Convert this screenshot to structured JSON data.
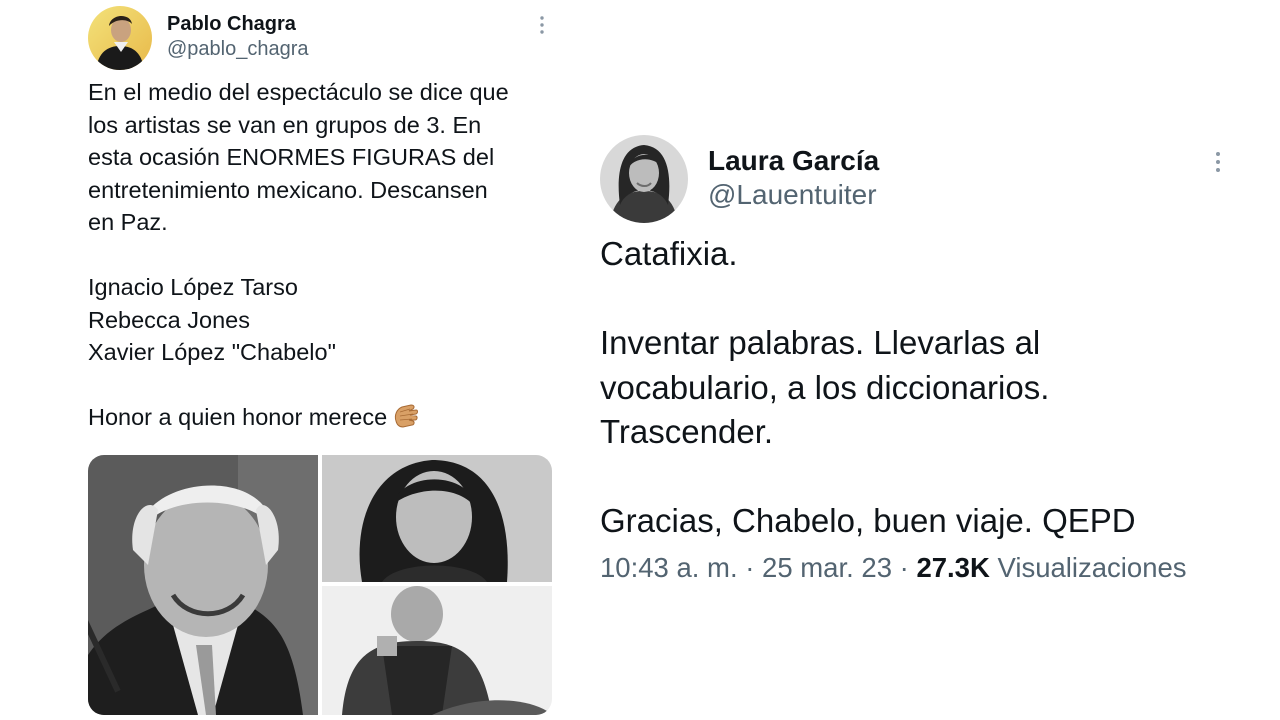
{
  "left_tweet": {
    "author_name": "Pablo Chagra",
    "author_handle": "@pablo_chagra",
    "body_lines_1": [
      "En el medio del espectáculo se dice que",
      "los artistas se van en grupos de 3. En",
      "esta ocasión ENORMES FIGURAS del",
      "entretenimiento mexicano. Descansen",
      "en Paz."
    ],
    "names_list": [
      "Ignacio López Tarso",
      "Rebecca Jones",
      "Xavier López \"Chabelo\""
    ],
    "closing_line": "Honor a quien honor merece",
    "closing_emoji_icon": "clapping-hands-icon",
    "media_count": 3
  },
  "right_tweet": {
    "author_name": "Laura García",
    "author_handle": "@Lauentuiter",
    "body_line_1": "Catafixia.",
    "body_lines_2": [
      "Inventar palabras. Llevarlas al",
      "vocabulario, a los diccionarios.",
      "Trascender."
    ],
    "body_line_3": "Gracias, Chabelo, buen viaje. QEPD",
    "time": "10:43 a. m.",
    "separator": " · ",
    "date": "25 mar. 23",
    "views_count": "27.3K",
    "views_label": " Visualizaciones"
  },
  "colors": {
    "text_primary": "#0f1419",
    "text_secondary": "#536471"
  }
}
